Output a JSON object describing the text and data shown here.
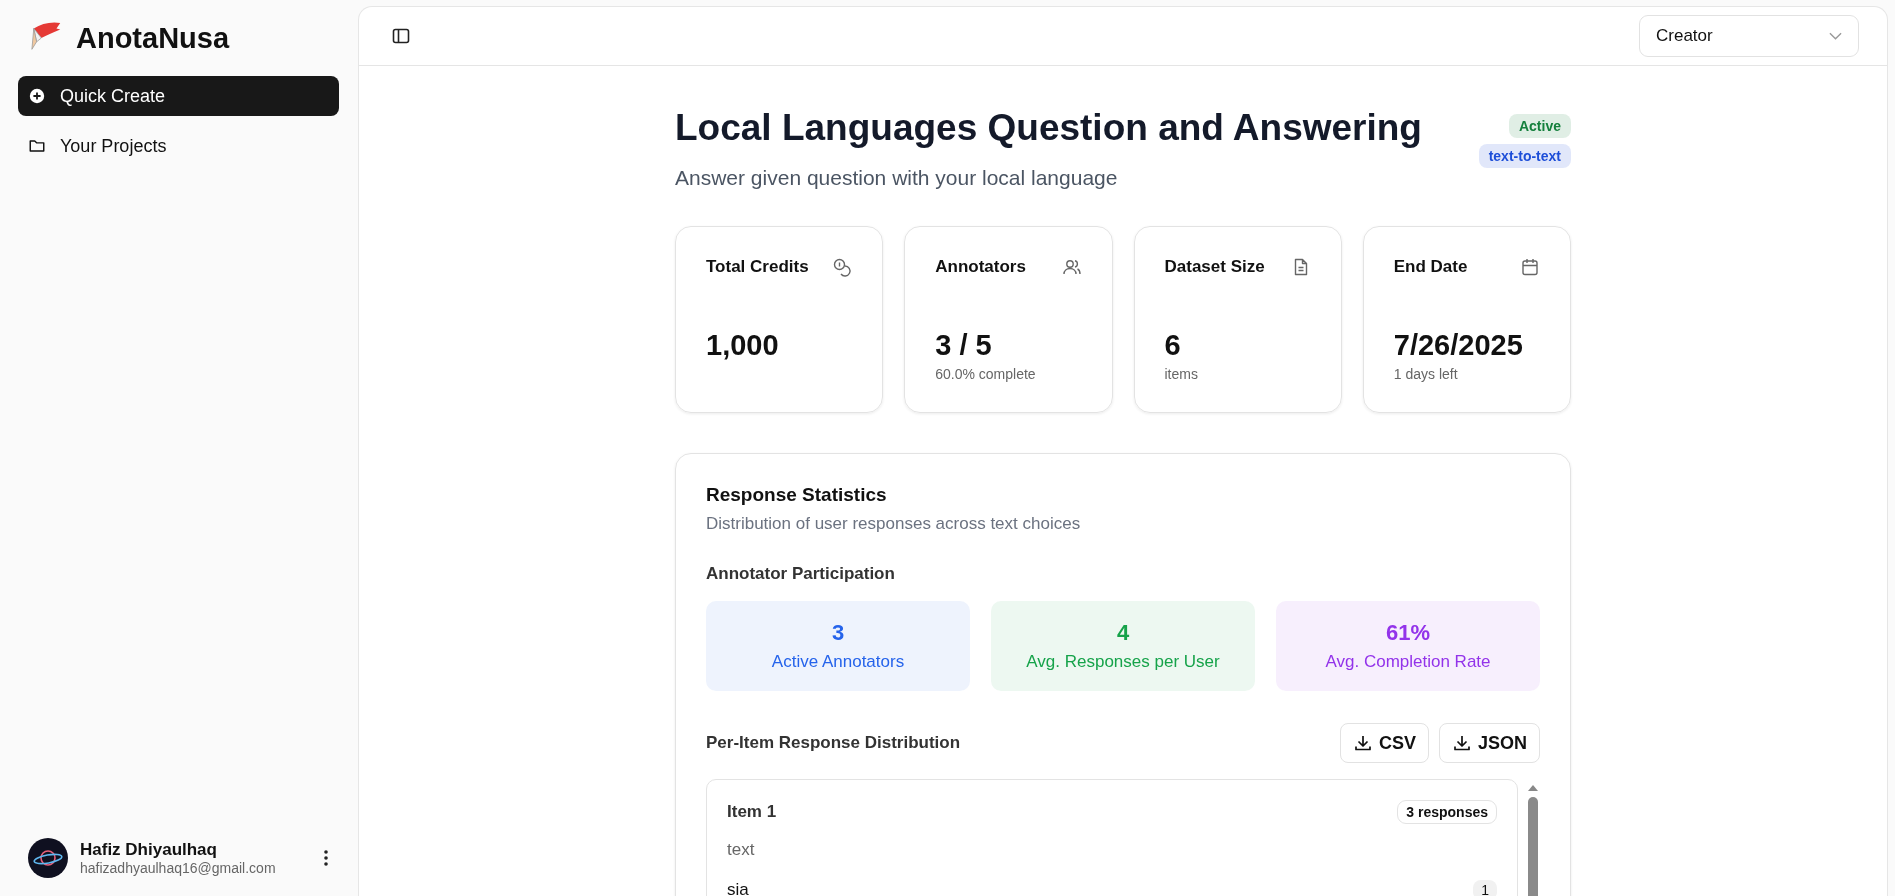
{
  "sidebar": {
    "brand": "AnotaNusa",
    "items": [
      {
        "label": "Quick Create",
        "selected": true
      },
      {
        "label": "Your Projects",
        "selected": false
      }
    ],
    "user": {
      "name": "Hafiz Dhiyaulhaq",
      "email": "hafizadhyaulhaq16@gmail.com"
    }
  },
  "header": {
    "role_select": {
      "value": "Creator"
    }
  },
  "project": {
    "title": "Local Languages Question and Answering",
    "subtitle": "Answer given question with your local language",
    "badges": [
      {
        "label": "Active",
        "color": "#15803d"
      },
      {
        "label": "text-to-text",
        "color": "#1d4ed8"
      }
    ]
  },
  "stat_cards": [
    {
      "title": "Total Credits",
      "value": "1,000"
    },
    {
      "title": "Annotators",
      "value": "3 / 5",
      "note": "60.0% complete"
    },
    {
      "title": "Dataset Size",
      "value": "6",
      "note": "items"
    },
    {
      "title": "End Date",
      "value": "7/26/2025",
      "note": "1 days left"
    }
  ],
  "response_statistics": {
    "title": "Response Statistics",
    "subtitle": "Distribution of user responses across text choices",
    "participation_title": "Annotator Participation",
    "participation": [
      {
        "value": "3",
        "label": "Active Annotators",
        "color": "#2563eb"
      },
      {
        "value": "4",
        "label": "Avg. Responses per User",
        "color": "#16a34a"
      },
      {
        "value": "61%",
        "label": "Avg. Completion Rate",
        "color": "#9333ea"
      }
    ],
    "distribution_title": "Per-Item Response Distribution",
    "export_buttons": [
      "CSV",
      "JSON"
    ],
    "items": [
      {
        "title": "Item 1",
        "count": "3 responses",
        "type": "text",
        "answers": [
          {
            "text": "sia",
            "count": "1"
          }
        ]
      }
    ]
  }
}
